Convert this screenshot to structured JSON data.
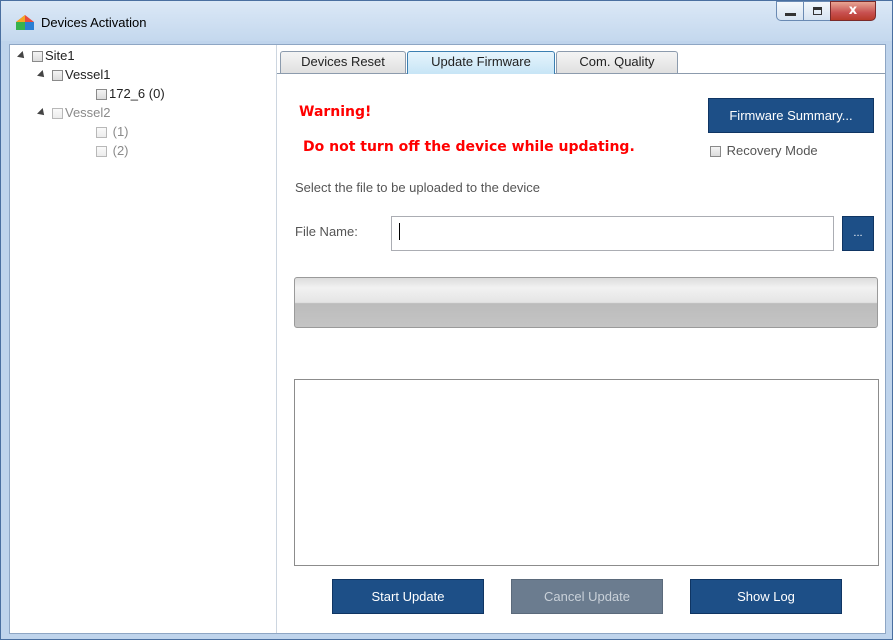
{
  "window": {
    "title": "Devices Activation",
    "controls": {
      "minimize": "minimize",
      "maximize": "maximize",
      "close": "x"
    }
  },
  "tree": {
    "site": {
      "label": "Site1"
    },
    "vessel1": {
      "label": "Vessel1",
      "device": "172_6 (0)"
    },
    "vessel2": {
      "label": "Vessel2",
      "devices": [
        "(1)",
        "(2)"
      ]
    }
  },
  "tabs": [
    "Devices Reset",
    "Update Firmware",
    "Com. Quality"
  ],
  "active_tab": "Update Firmware",
  "update": {
    "warning_title": "Warning!",
    "warning_text": "Do not turn off the device while updating.",
    "firmware_summary_label": "Firmware Summary...",
    "recovery_mode_label": "Recovery Mode",
    "recovery_mode_checked": false,
    "instruction": "Select the file to be uploaded to the device",
    "file_label": "File Name:",
    "file_value": "",
    "browse_label": "...",
    "progress_fraction": 0,
    "log_text": "",
    "start_label": "Start Update",
    "cancel_label": "Cancel Update",
    "cancel_enabled": false,
    "show_log_label": "Show Log"
  },
  "colors": {
    "warning": "#ff0000",
    "button": "#1d4f87",
    "button_disabled": "#6b7c8f",
    "active_tab": "#c7e5f6"
  }
}
